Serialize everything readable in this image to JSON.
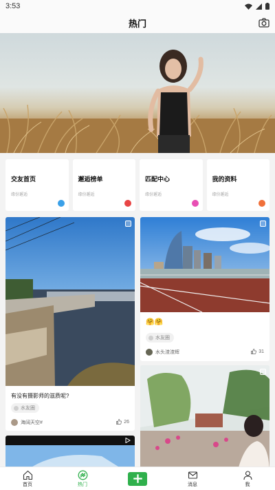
{
  "status_bar": {
    "time": "3:53"
  },
  "header": {
    "title": "热门"
  },
  "quick_entries": [
    {
      "title": "交友首页",
      "subtitle": "缘份邂逅",
      "icon": "chat-icon",
      "color": "#3aa0e8"
    },
    {
      "title": "邂逅榜单",
      "subtitle": "缘份邂逅",
      "icon": "star-icon",
      "color": "#e84545"
    },
    {
      "title": "匹配中心",
      "subtitle": "缘份邂逅",
      "icon": "heart-icon",
      "color": "#e84fb4"
    },
    {
      "title": "我的资料",
      "subtitle": "缘份邂逅",
      "icon": "profile-icon",
      "color": "#f0703a"
    }
  ],
  "feed": {
    "left": [
      {
        "caption": "有没有摄影师的滋质呢?",
        "tag": "水友圈",
        "author": "海阔天空#",
        "likes": "26"
      }
    ],
    "right": [
      {
        "caption": "🤗🤗",
        "tag": "水友圈",
        "author": "水头渣渣辉",
        "likes": "31"
      }
    ]
  },
  "bottom_nav": [
    {
      "label": "首页",
      "icon": "home-icon"
    },
    {
      "label": "热门",
      "icon": "hot-icon",
      "active": true
    },
    {
      "label": "",
      "icon": "plus-icon"
    },
    {
      "label": "消息",
      "icon": "mail-icon"
    },
    {
      "label": "我",
      "icon": "user-icon"
    }
  ],
  "colors": {
    "accent": "#2fb04c",
    "background": "#f3f3f3"
  }
}
